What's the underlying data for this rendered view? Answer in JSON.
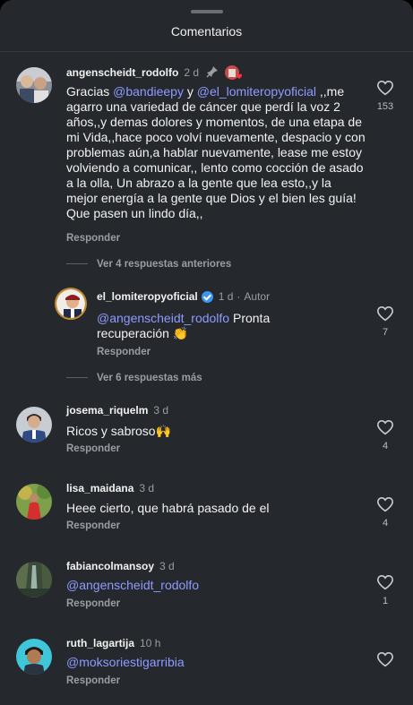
{
  "header": {
    "title": "Comentarios"
  },
  "comments": [
    {
      "username": "angenscheidt_rodolfo",
      "time": "2 d",
      "pin_icon": "pin-icon",
      "mention1": "@bandieepy",
      "text_a": "Gracias ",
      "text_b": " y ",
      "mention2": "@el_lomiteropyoficial",
      "text_c": " ,,me agarro una variedad de cáncer que perdí la voz 2 años,,y demas dolores y momentos, de una etapa de mi Vida,,hace poco volví nuevamente, despacio y con problemas aún,a hablar nuevamente, lease me estoy volviendo a comunicar,, lento como cocción de asado a la olla, Un abrazo a la gente que lea esto,,y la mejor energía a la gente que Dios y el bien les guía! Que pasen un lindo día,,",
      "reply": "Responder",
      "likes": "153"
    },
    {
      "username": "el_lomiteropyoficial",
      "time": "1 d",
      "author_tag": "Autor",
      "mention": "@angenscheidt_rodolfo",
      "text": " Pronta recuperación 👏",
      "reply": "Responder",
      "likes": "7"
    },
    {
      "username": "josema_riquelm",
      "time": "3 d",
      "text": "Ricos y sabroso🙌",
      "reply": "Responder",
      "likes": "4"
    },
    {
      "username": "lisa_maidana",
      "time": "3 d",
      "text": "Heee cierto, que habrá pasado de el",
      "reply": "Responder",
      "likes": "4"
    },
    {
      "username": "fabiancolmansoy",
      "time": "3 d",
      "mention": "@angenscheidt_rodolfo",
      "reply": "Responder",
      "likes": "1"
    },
    {
      "username": "ruth_lagartija",
      "time": "10 h",
      "mention": "@moksoriestigarribia",
      "reply": "Responder"
    }
  ],
  "threads": {
    "previous_replies": "Ver 4 respuestas anteriores",
    "more_replies": "Ver 6 respuestas más"
  },
  "colors": {
    "background": "#25282d",
    "mention": "#8e9bff",
    "muted": "#9a9da2",
    "verified": "#3897f0"
  }
}
